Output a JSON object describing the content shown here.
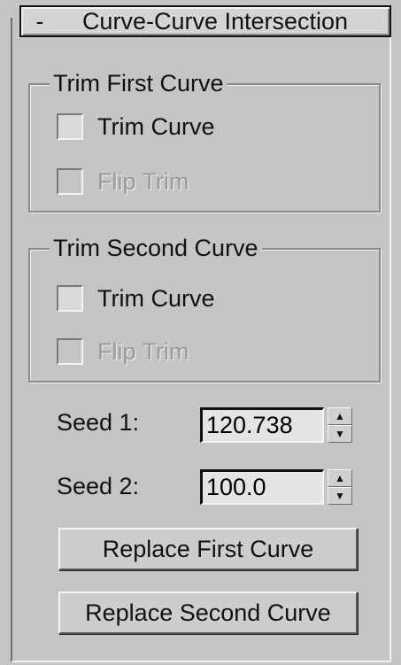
{
  "rollout": {
    "collapse_symbol": "-",
    "title": "Curve-Curve Intersection"
  },
  "group_first": {
    "title": "Trim First Curve",
    "trim_label": "Trim Curve",
    "flip_label": "Flip Trim"
  },
  "group_second": {
    "title": "Trim Second Curve",
    "trim_label": "Trim Curve",
    "flip_label": "Flip Trim"
  },
  "seed1": {
    "label": "Seed 1:",
    "value": "120.738"
  },
  "seed2": {
    "label": "Seed 2:",
    "value": "100.0"
  },
  "buttons": {
    "replace_first": "Replace First Curve",
    "replace_second": "Replace Second Curve"
  },
  "icons": {
    "collapse": "minus-icon",
    "up": "arrow-up-icon",
    "down": "arrow-down-icon"
  }
}
